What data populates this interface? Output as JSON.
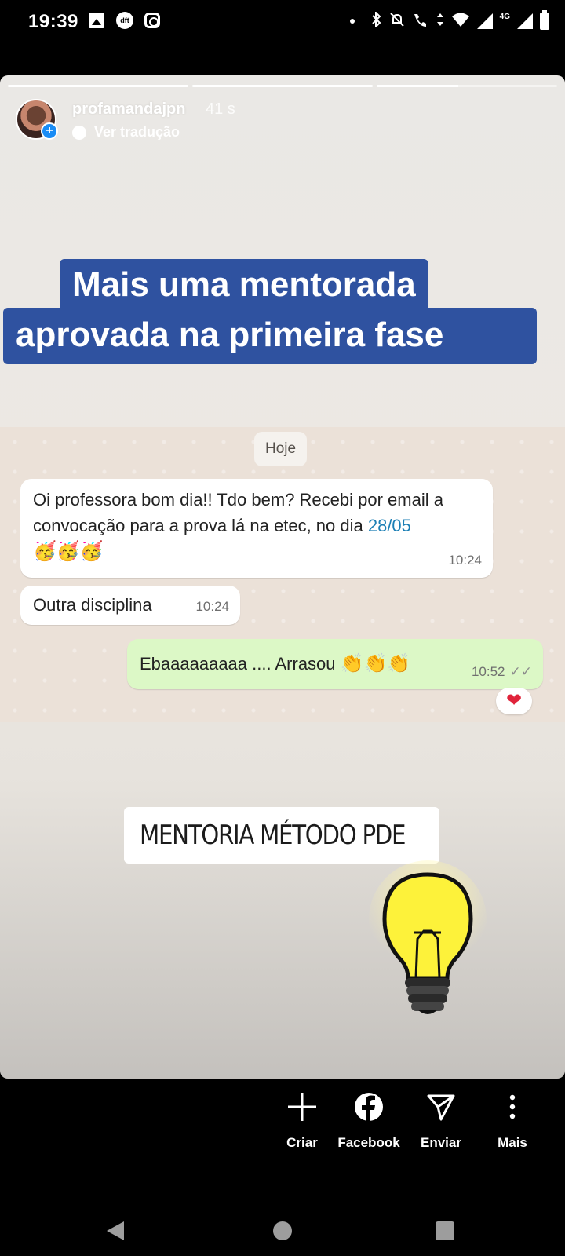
{
  "status_bar": {
    "time": "19:39",
    "left_icons": [
      "image-icon",
      "dft-icon",
      "instagram-icon"
    ],
    "dft_label": "dft",
    "net_label": "4G",
    "right_icons": [
      "notification-dot-icon",
      "bluetooth-icon",
      "mute-icon",
      "call-4g-icon",
      "data-arrows-icon",
      "wifi-icon",
      "signal-icon",
      "signal-4g-icon",
      "battery-icon"
    ]
  },
  "story": {
    "progress_segments": [
      1,
      1,
      0.45
    ],
    "username": "profamandajpn",
    "time_ago": "41 s",
    "translate_label": "Ver tradução",
    "headline_line1": "Mais uma mentorada",
    "headline_line2": "aprovada na primeira fase",
    "headline_color": "#2f52a0"
  },
  "chat": {
    "day_label": "Hoje",
    "messages": [
      {
        "text_part1": "Oi professora bom dia!! Tdo bem? Recebi por email a convocação para a prova lá na etec, no dia ",
        "date_link": "28/05",
        "emojis": "🥳🥳🥳",
        "time": "10:24",
        "direction": "incoming"
      },
      {
        "text": "Outra disciplina",
        "time": "10:24",
        "direction": "incoming"
      },
      {
        "text": "Ebaaaaaaaaa .... Arrasou ",
        "emojis": "👏👏👏",
        "time": "10:52",
        "ticks": "✓✓",
        "direction": "outgoing",
        "reaction": "❤"
      }
    ],
    "outgoing_bubble_color": "#dcf8c6"
  },
  "link_sticker": {
    "label": "MENTORIA MÉTODO PDE",
    "icon": "link-icon"
  },
  "sticker_bulb": "lightbulb-icon",
  "actions": [
    {
      "label": "Criar",
      "icon": "plus-icon"
    },
    {
      "label": "Facebook",
      "icon": "facebook-icon"
    },
    {
      "label": "Enviar",
      "icon": "send-icon"
    },
    {
      "label": "Mais",
      "icon": "more-vertical-icon"
    }
  ],
  "navbar": [
    "back-icon",
    "home-icon",
    "recents-icon"
  ]
}
